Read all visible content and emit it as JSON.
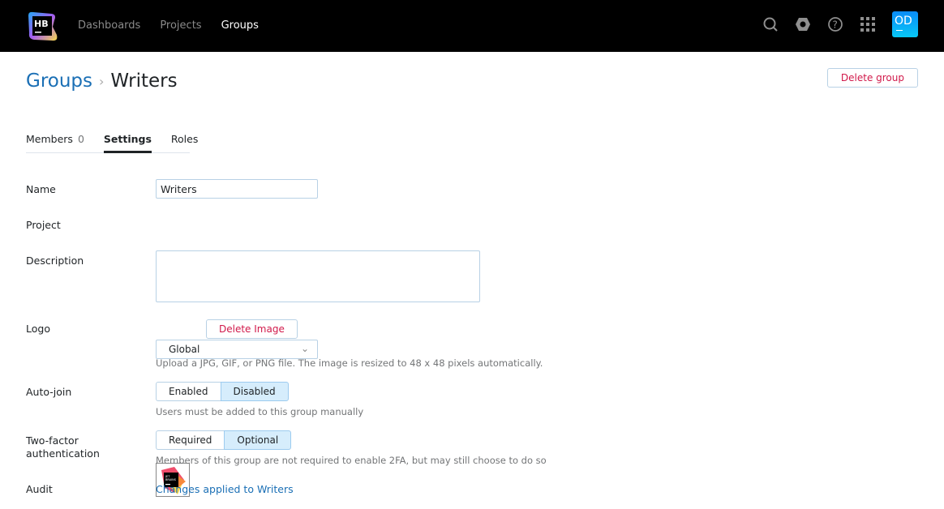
{
  "topbar": {
    "logo_text": "HB",
    "nav": [
      "Dashboards",
      "Projects",
      "Groups"
    ],
    "active": "Groups",
    "avatar": "OD"
  },
  "breadcrumb": {
    "parent": "Groups",
    "separator": "›",
    "current": "Writers"
  },
  "delete_group": "Delete group",
  "tabs": {
    "members": "Members",
    "members_count": "0",
    "settings": "Settings",
    "roles": "Roles"
  },
  "form": {
    "name_label": "Name",
    "name_value": "Writers",
    "project_label": "Project",
    "project_value": "Global",
    "description_label": "Description",
    "description_value": "",
    "logo_label": "Logo",
    "logo_image_text": "JET BRAINS",
    "delete_image": "Delete Image",
    "logo_hint": "Upload a JPG, GIF, or PNG file. The image is resized to 48 x 48 pixels automatically.",
    "autojoin_label": "Auto-join",
    "autojoin_options": [
      "Enabled",
      "Disabled"
    ],
    "autojoin_selected": "Disabled",
    "autojoin_hint": "Users must be added to this group manually",
    "tfa_label_1": "Two-factor",
    "tfa_label_2": "authentication",
    "tfa_options": [
      "Required",
      "Optional"
    ],
    "tfa_selected": "Optional",
    "tfa_hint": "Members of this group are not required to enable 2FA, but may still choose to do so",
    "audit_label": "Audit",
    "audit_link": "Changes applied to Writers"
  },
  "colors": {
    "accent": "#1a6fb5",
    "danger": "#d1194a",
    "selected": "#d6edfc"
  }
}
